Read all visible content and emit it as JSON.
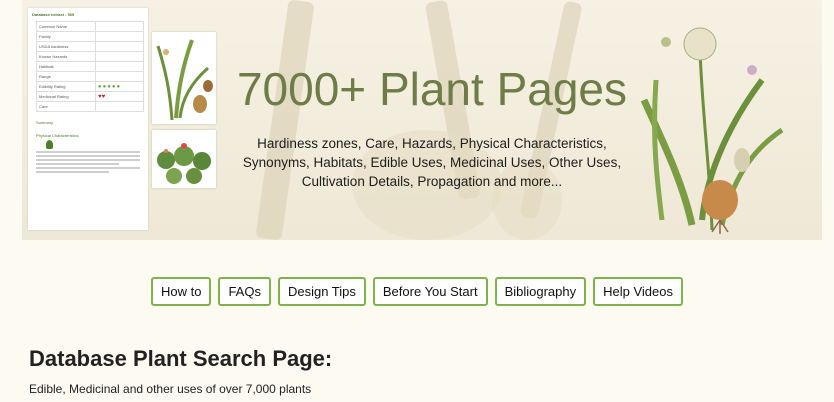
{
  "banner": {
    "title": "7000+ Plant Pages",
    "subtitle": "Hardiness zones, Care, Hazards, Physical Characteristics, Synonyms, Habitats, Edible Uses, Medicinal Uses, Other Uses, Cultivation Details, Propagation and more...",
    "sheet_heading": "Database extract - 909",
    "sheet_rows": [
      "Common Name",
      "Family",
      "USDA hardiness",
      "Known Hazards",
      "Habitats",
      "Range",
      "Edibility Rating",
      "Medicinal Rating",
      "Care"
    ],
    "sheet_sub_heading_1": "Summary",
    "sheet_sub_heading_2": "Physical Characteristics"
  },
  "nav": {
    "items": [
      "How to",
      "FAQs",
      "Design Tips",
      "Before You Start",
      "Bibliography",
      "Help Videos"
    ]
  },
  "page": {
    "heading": "Database Plant Search Page:",
    "lead": "Edible, Medicinal and other uses of over 7,000 plants"
  },
  "colors": {
    "title": "#6e7c47",
    "nav_border": "#7fb34a",
    "background": "#fdfaf2"
  }
}
